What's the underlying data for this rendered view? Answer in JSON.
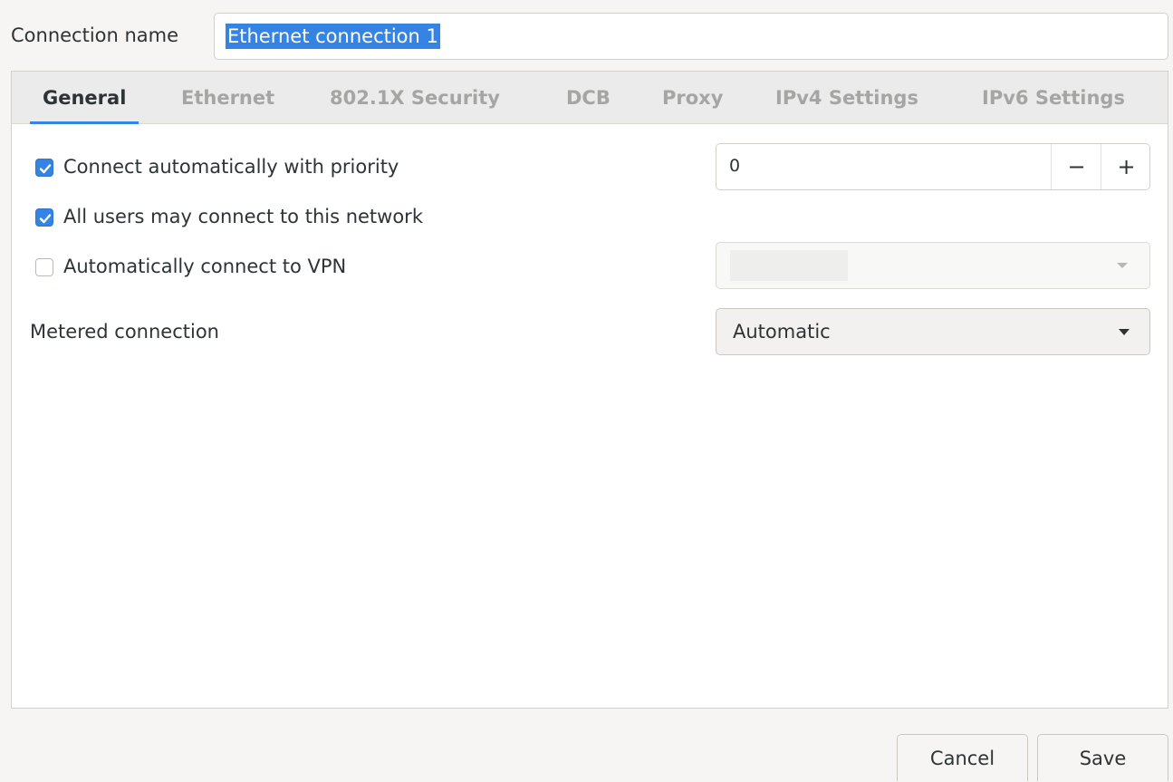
{
  "connection": {
    "name_label": "Connection name",
    "name_value": "Ethernet connection 1"
  },
  "tabs": [
    {
      "label": "General",
      "active": true
    },
    {
      "label": "Ethernet",
      "active": false
    },
    {
      "label": "802.1X Security",
      "active": false
    },
    {
      "label": "DCB",
      "active": false
    },
    {
      "label": "Proxy",
      "active": false
    },
    {
      "label": "IPv4 Settings",
      "active": false
    },
    {
      "label": "IPv6 Settings",
      "active": false
    }
  ],
  "general": {
    "auto_connect": {
      "label": "Connect automatically with priority",
      "checked": true
    },
    "priority": {
      "value": "0",
      "decrement": "−",
      "increment": "+"
    },
    "all_users": {
      "label": "All users may connect to this network",
      "checked": true
    },
    "auto_vpn": {
      "label": "Automatically connect to VPN",
      "checked": false
    },
    "metered": {
      "label": "Metered connection",
      "value": "Automatic"
    }
  },
  "footer": {
    "cancel_label": "Cancel",
    "save_label": "Save"
  },
  "colors": {
    "accent": "#3584e4",
    "background": "#f6f5f4"
  },
  "icons": {
    "checkbox_checked": "check-icon",
    "combo_arrow": "chevron-down-icon"
  }
}
